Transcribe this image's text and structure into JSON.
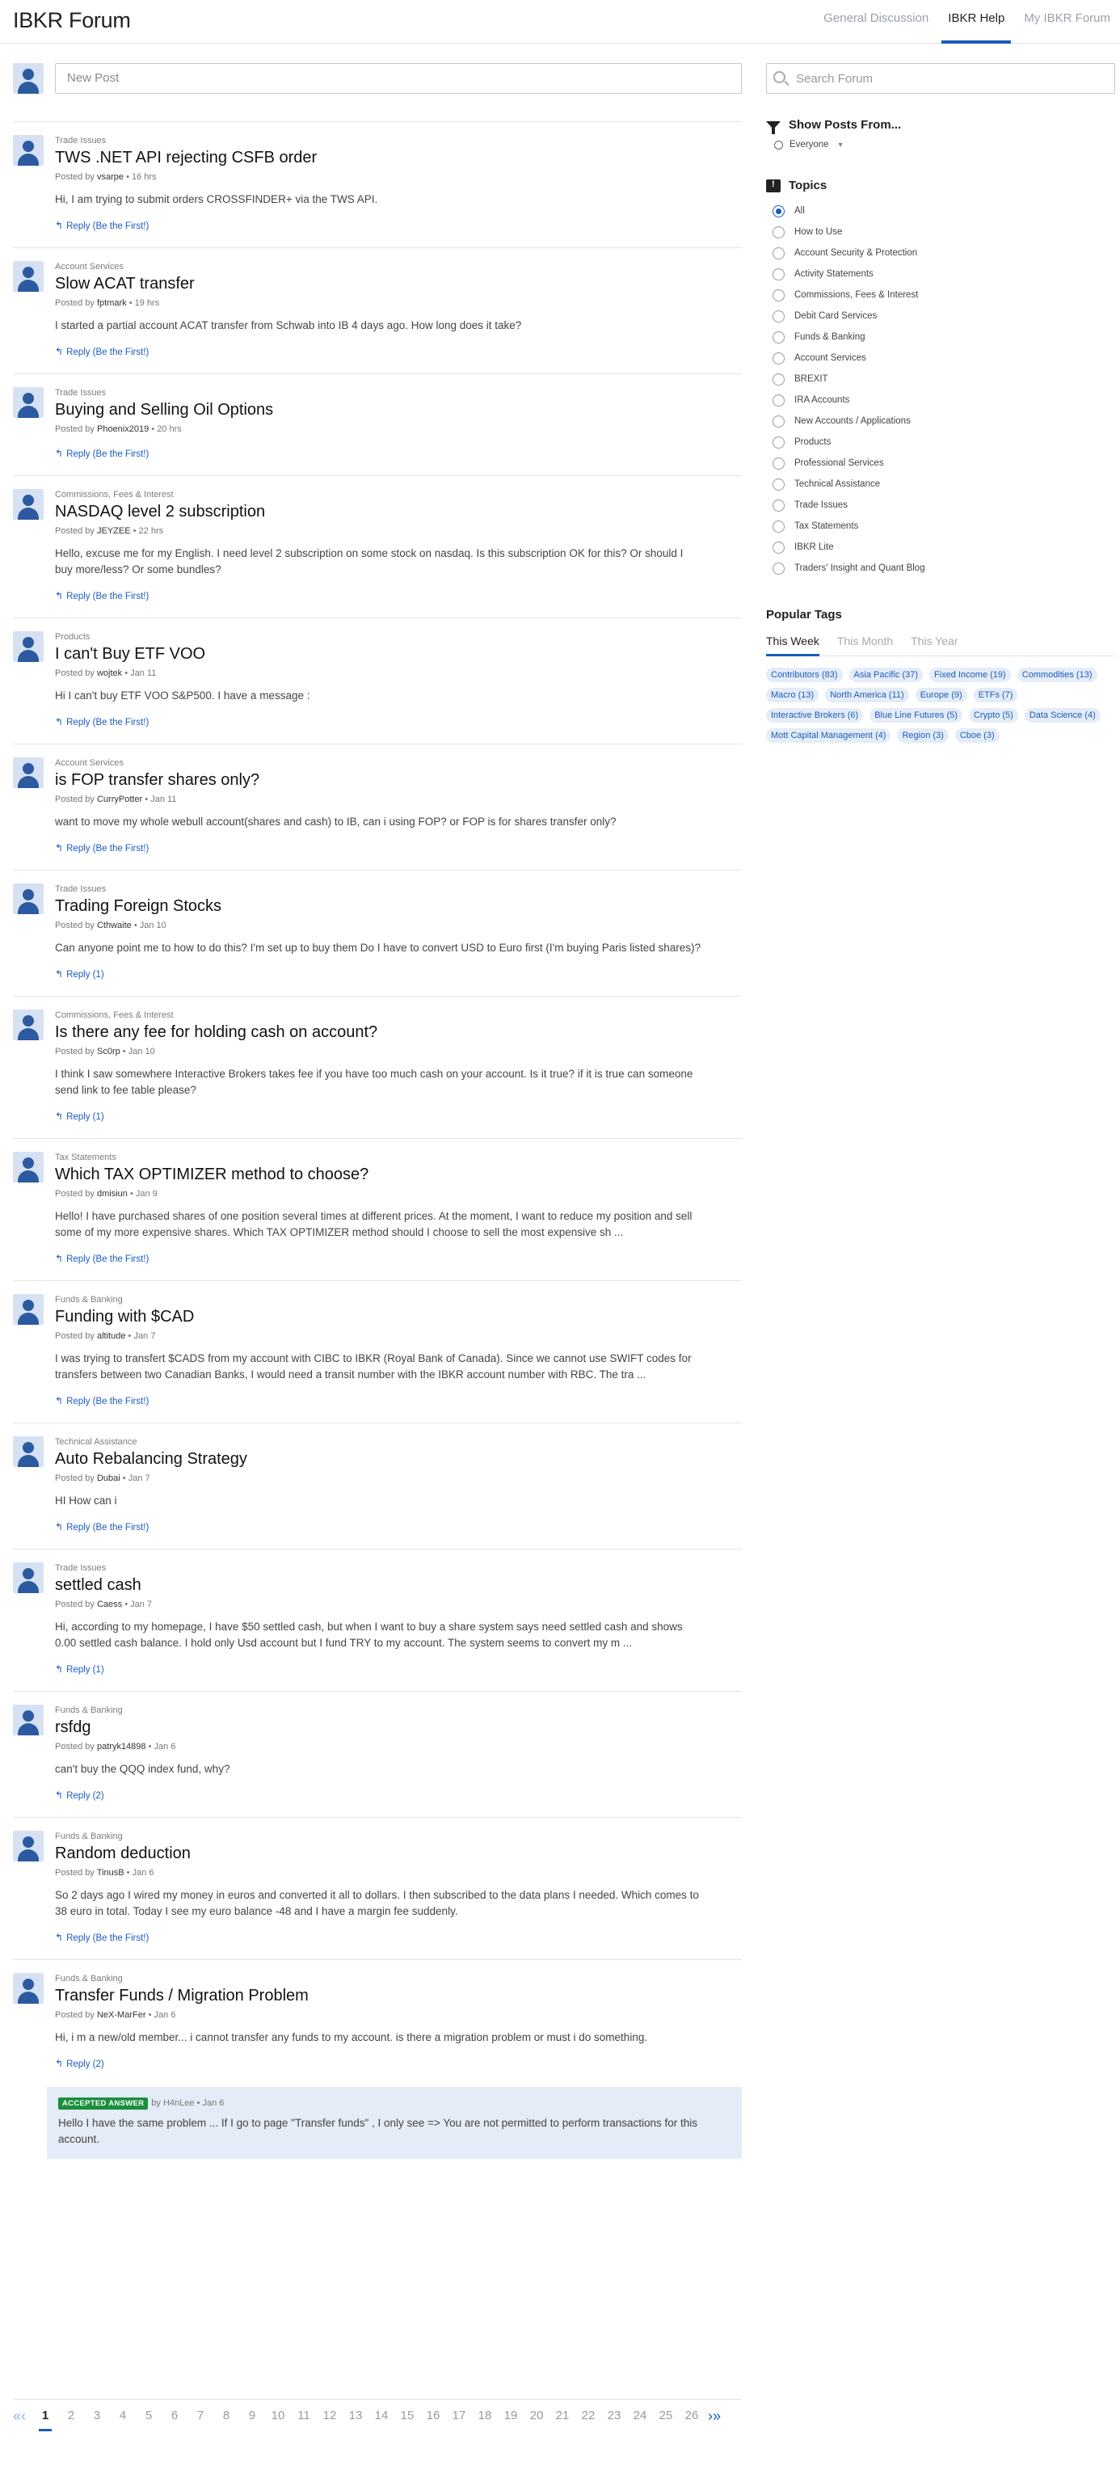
{
  "header": {
    "brand": "IBKR Forum",
    "nav": [
      {
        "label": "General Discussion",
        "active": false
      },
      {
        "label": "IBKR Help",
        "active": true
      },
      {
        "label": "My IBKR Forum",
        "active": false
      }
    ]
  },
  "new_post": {
    "placeholder": "New Post"
  },
  "search": {
    "placeholder": "Search Forum"
  },
  "posts": [
    {
      "category": "Trade Issues",
      "title": "TWS .NET API rejecting CSFB order",
      "posted_by": "Posted by",
      "author": "vsarpe",
      "time": "• 16 hrs",
      "body": "Hi, I am trying to submit orders CROSSFINDER+ via the TWS API.",
      "reply": "Reply (Be the First!)"
    },
    {
      "category": "Account Services",
      "title": "Slow ACAT transfer",
      "posted_by": "Posted by",
      "author": "fptmark",
      "time": "• 19 hrs",
      "body": "I started a partial account ACAT transfer from Schwab into IB 4 days ago. How long does it take?",
      "reply": "Reply (Be the First!)"
    },
    {
      "category": "Trade Issues",
      "title": "Buying and Selling Oil Options",
      "posted_by": "Posted by",
      "author": "Phoenix2019",
      "time": "• 20 hrs",
      "body": "",
      "reply": "Reply (Be the First!)"
    },
    {
      "category": "Commissions, Fees & Interest",
      "title": "NASDAQ level 2 subscription",
      "posted_by": "Posted by",
      "author": "JEYZEE",
      "time": "• 22 hrs",
      "body": "Hello, excuse me for my English. I need level 2 subscription on some stock on nasdaq. Is this subscription OK for this? Or should I buy more/less? Or some bundles?",
      "reply": "Reply (Be the First!)"
    },
    {
      "category": "Products",
      "title": "I can't Buy ETF VOO",
      "posted_by": "Posted by",
      "author": "wojtek",
      "time": "• Jan 11",
      "body": "Hi I can't buy ETF VOO S&P500. I have a message :",
      "reply": "Reply (Be the First!)"
    },
    {
      "category": "Account Services",
      "title": "is FOP transfer shares only?",
      "posted_by": "Posted by",
      "author": "CurryPotter",
      "time": "• Jan 11",
      "body": "want to move my whole webull account(shares and cash) to IB, can i using FOP? or FOP is for shares transfer only?",
      "reply": "Reply (Be the First!)"
    },
    {
      "category": "Trade Issues",
      "title": "Trading Foreign Stocks",
      "posted_by": "Posted by",
      "author": "Cthwaite",
      "time": "• Jan 10",
      "body": "Can anyone point me to how to do this? I'm set up to buy them Do I have to convert USD to Euro first (I'm buying Paris listed shares)?",
      "reply": "Reply (1)"
    },
    {
      "category": "Commissions, Fees & Interest",
      "title": "Is there any fee for holding cash on account?",
      "posted_by": "Posted by",
      "author": "Sc0rp",
      "time": "• Jan 10",
      "body": "I think I saw somewhere Interactive Brokers takes fee if you have too much cash on your account. Is it true? if it is true can someone send link to fee table please?",
      "reply": "Reply (1)"
    },
    {
      "category": "Tax Statements",
      "title": "Which TAX OPTIMIZER method to choose?",
      "posted_by": "Posted by",
      "author": "dmisiun",
      "time": "• Jan 9",
      "body": "Hello! I have purchased shares of one position several times at different prices. At the moment, I want to reduce my position and sell some of my more expensive shares. Which TAX OPTIMIZER method should I choose to sell the most expensive sh ...",
      "reply": "Reply (Be the First!)"
    },
    {
      "category": "Funds & Banking",
      "title": "Funding with $CAD",
      "posted_by": "Posted by",
      "author": "altitude",
      "time": "• Jan 7",
      "body": "I was trying to transfert $CADS from my account with CIBC to IBKR (Royal Bank of Canada). Since we cannot use SWIFT codes for transfers between two Canadian Banks, I would need a transit number with the IBKR account number with RBC. The tra ...",
      "reply": "Reply (Be the First!)"
    },
    {
      "category": "Technical Assistance",
      "title": "Auto Rebalancing Strategy",
      "posted_by": "Posted by",
      "author": "Dubai",
      "time": "• Jan 7",
      "body": "HI How can i",
      "reply": "Reply (Be the First!)"
    },
    {
      "category": "Trade Issues",
      "title": "settled cash",
      "posted_by": "Posted by",
      "author": "Caess",
      "time": "• Jan 7",
      "body": "Hi, according to my homepage, I have $50 settled cash, but when I want to buy a share system says need settled cash and shows 0.00 settled cash balance. I hold only Usd account but I fund TRY to my account. The system seems to convert my m ...",
      "reply": "Reply (1)"
    },
    {
      "category": "Funds & Banking",
      "title": "rsfdg",
      "posted_by": "Posted by",
      "author": "patryk14898",
      "time": "• Jan 6",
      "body": "can't buy the QQQ index fund, why?",
      "reply": "Reply (2)"
    },
    {
      "category": "Funds & Banking",
      "title": "Random deduction",
      "posted_by": "Posted by",
      "author": "TinusB",
      "time": "• Jan 6",
      "body": "So 2 days ago I wired my money in euros and converted it all to dollars. I then subscribed to the data plans I needed. Which comes to 38 euro in total. Today I see my euro balance -48 and I have a margin fee suddenly.",
      "reply": "Reply (Be the First!)"
    },
    {
      "category": "Funds & Banking",
      "title": "Transfer Funds / Migration Problem",
      "posted_by": "Posted by",
      "author": "NeX-MarFer",
      "time": "• Jan 6",
      "body": "Hi, i m a new/old member... i cannot transfer any funds to my account. is there a migration problem or must i do something.",
      "reply": "Reply (2)"
    }
  ],
  "accepted_answer": {
    "badge": "ACCEPTED ANSWER",
    "by": "by",
    "author": "H4nLee",
    "time": "• Jan 6",
    "body": "Hello I have the same problem ... If I go to page \"Transfer funds\" , I only see => You are not permitted to perform transactions for this account."
  },
  "pagination": {
    "prev": "«‹",
    "next": "›»",
    "pages": [
      "1",
      "2",
      "3",
      "4",
      "5",
      "6",
      "7",
      "8",
      "9",
      "10",
      "11",
      "12",
      "13",
      "14",
      "15",
      "16",
      "17",
      "18",
      "19",
      "20",
      "21",
      "22",
      "23",
      "24",
      "25",
      "26"
    ],
    "current": "1"
  },
  "sidebar": {
    "show_posts_title": "Show Posts From...",
    "show_posts_value": "Everyone",
    "topics_title": "Topics",
    "topics": [
      "All",
      "How to Use",
      "Account Security & Protection",
      "Activity Statements",
      "Commissions, Fees & Interest",
      "Debit Card Services",
      "Funds & Banking",
      "Account Services",
      "BREXIT",
      "IRA Accounts",
      "New Accounts / Applications",
      "Products",
      "Professional Services",
      "Technical Assistance",
      "Trade Issues",
      "Tax Statements",
      "IBKR Lite",
      "Traders' Insight and Quant Blog"
    ],
    "topics_selected": "All",
    "popular_title": "Popular Tags",
    "popular_tabs": [
      {
        "label": "This Week",
        "active": true
      },
      {
        "label": "This Month",
        "active": false
      },
      {
        "label": "This Year",
        "active": false
      }
    ],
    "tags": [
      "Contributors (83)",
      "Asia Pacific (37)",
      "Fixed Income (19)",
      "Commodities (13)",
      "Macro (13)",
      "North America (11)",
      "Europe (9)",
      "ETFs (7)",
      "Interactive Brokers (6)",
      "Blue Line Futures (5)",
      "Crypto (5)",
      "Data Science (4)",
      "Mott Capital Management (4)",
      "Region (3)",
      "Cboe (3)"
    ]
  },
  "colors": {
    "accent": "#1b5bbd",
    "tag_bg": "#e4ecf7",
    "accepted_badge": "#1a8f3c"
  }
}
